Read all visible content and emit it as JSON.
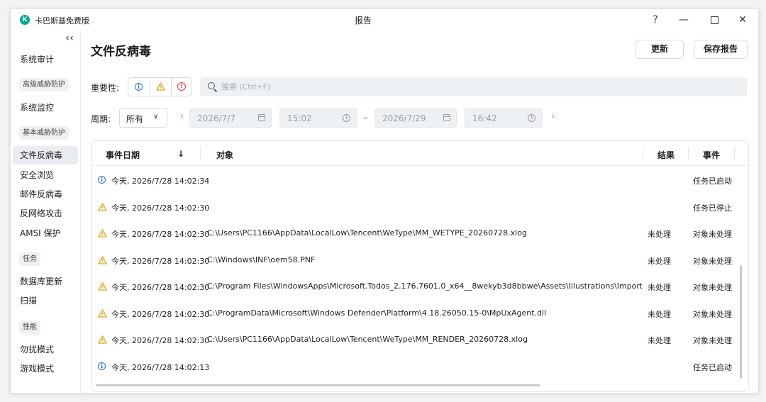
{
  "app": {
    "name": "卡巴斯基免费版",
    "logo_letter": "K",
    "window_title": "报告",
    "help": "?",
    "minimize": "—",
    "close": "✕"
  },
  "sidebar": {
    "collapse": "‹‹",
    "items": [
      {
        "label": "系统审计",
        "type": "item"
      },
      {
        "label": "高级威胁防护",
        "type": "section"
      },
      {
        "label": "系统监控",
        "type": "item"
      },
      {
        "label": "基本威胁防护",
        "type": "section"
      },
      {
        "label": "文件反病毒",
        "type": "item",
        "selected": true
      },
      {
        "label": "安全浏览",
        "type": "item"
      },
      {
        "label": "邮件反病毒",
        "type": "item"
      },
      {
        "label": "反网络攻击",
        "type": "item"
      },
      {
        "label": "AMSI 保护",
        "type": "item"
      },
      {
        "label": "任务",
        "type": "section"
      },
      {
        "label": "数据库更新",
        "type": "item"
      },
      {
        "label": "扫描",
        "type": "item"
      },
      {
        "label": "性能",
        "type": "section"
      },
      {
        "label": "勿扰模式",
        "type": "item"
      },
      {
        "label": "游戏模式",
        "type": "item"
      }
    ]
  },
  "main": {
    "title": "文件反病毒",
    "update_button": "更新",
    "save_button": "保存报告",
    "severity_label": "重要性:",
    "search_placeholder": "搜索 (Ctrl+F)",
    "period_label": "周期:",
    "period_value": "所有",
    "prev": "‹",
    "next": "›",
    "dash": "–",
    "from_date": "2026/7/7",
    "from_time": "15:02",
    "to_date": "2026/7/29",
    "to_time": "16:42"
  },
  "table": {
    "columns": {
      "date": "事件日期",
      "sort": "↓",
      "object": "对象",
      "result": "结果",
      "event": "事件"
    },
    "rows": [
      {
        "severity": "info",
        "date": "今天, 2026/7/28 14:02:34",
        "object": "",
        "result": "",
        "event": "任务已启动"
      },
      {
        "severity": "warning",
        "date": "今天, 2026/7/28 14:02:30",
        "object": "",
        "result": "",
        "event": "任务已停止"
      },
      {
        "severity": "warning",
        "date": "今天, 2026/7/28 14:02:30",
        "object": "C:\\Users\\PC1166\\AppData\\LocalLow\\Tencent\\WeType\\MM_WETYPE_20260728.xlog",
        "result": "未处理",
        "event": "对象未处理"
      },
      {
        "severity": "warning",
        "date": "今天, 2026/7/28 14:02:30",
        "object": "C:\\Windows\\INF\\oem58.PNF",
        "result": "未处理",
        "event": "对象未处理"
      },
      {
        "severity": "warning",
        "date": "今天, 2026/7/28 14:02:30",
        "object": "C:\\Program Files\\WindowsApps\\Microsoft.Todos_2.176.7601.0_x64__8wekyb3d8bbwe\\Assets\\Illustrations\\Importer\\Notificati",
        "result": "未处理",
        "event": "对象未处理"
      },
      {
        "severity": "warning",
        "date": "今天, 2026/7/28 14:02:30",
        "object": "C:\\ProgramData\\Microsoft\\Windows Defender\\Platform\\4.18.26050.15-0\\MpUxAgent.dll",
        "result": "未处理",
        "event": "对象未处理"
      },
      {
        "severity": "warning",
        "date": "今天, 2026/7/28 14:02:30",
        "object": "C:\\Users\\PC1166\\AppData\\LocalLow\\Tencent\\WeType\\MM_RENDER_20260728.xlog",
        "result": "未处理",
        "event": "对象未处理"
      },
      {
        "severity": "info",
        "date": "今天, 2026/7/28 14:02:13",
        "object": "",
        "result": "",
        "event": "任务已启动"
      }
    ]
  },
  "colors": {
    "info": "#2a6fdb",
    "warning": "#e8a317",
    "error": "#e0312f",
    "accent_green": "#00a88e"
  }
}
